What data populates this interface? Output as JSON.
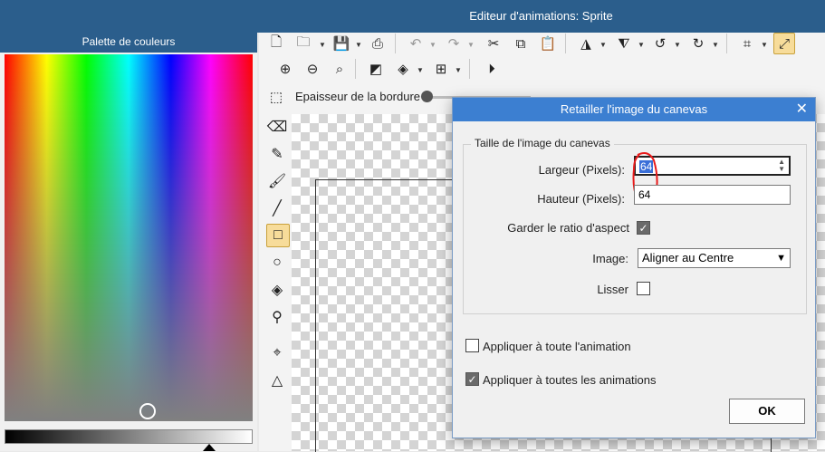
{
  "window": {
    "title": "Editeur d'animations: Sprite"
  },
  "palette": {
    "title": "Palette de couleurs"
  },
  "options_bar": {
    "border_thickness_label": "Epaisseur de la bordure"
  },
  "dialog": {
    "title": "Retailler l'image du canevas",
    "group_title": "Taille de l'image du canevas",
    "width_label": "Largeur (Pixels):",
    "width_value": "64",
    "height_label": "Hauteur (Pixels):",
    "height_value": "64",
    "keep_ratio_label": "Garder le ratio d'aspect",
    "keep_ratio_checked": true,
    "image_label": "Image:",
    "image_selected": "Aligner au Centre",
    "smooth_label": "Lisser",
    "smooth_checked": false,
    "apply_animation_label": "Appliquer à toute l'animation",
    "apply_animation_checked": false,
    "apply_all_label": "Appliquer à toutes les animations",
    "apply_all_checked": true,
    "ok_label": "OK"
  },
  "colors": {
    "title_bar": "#2b5e8c",
    "dialog_title": "#3c7fd1",
    "tool_active": "#f7dc9a",
    "annotation": "#e81b1b"
  }
}
